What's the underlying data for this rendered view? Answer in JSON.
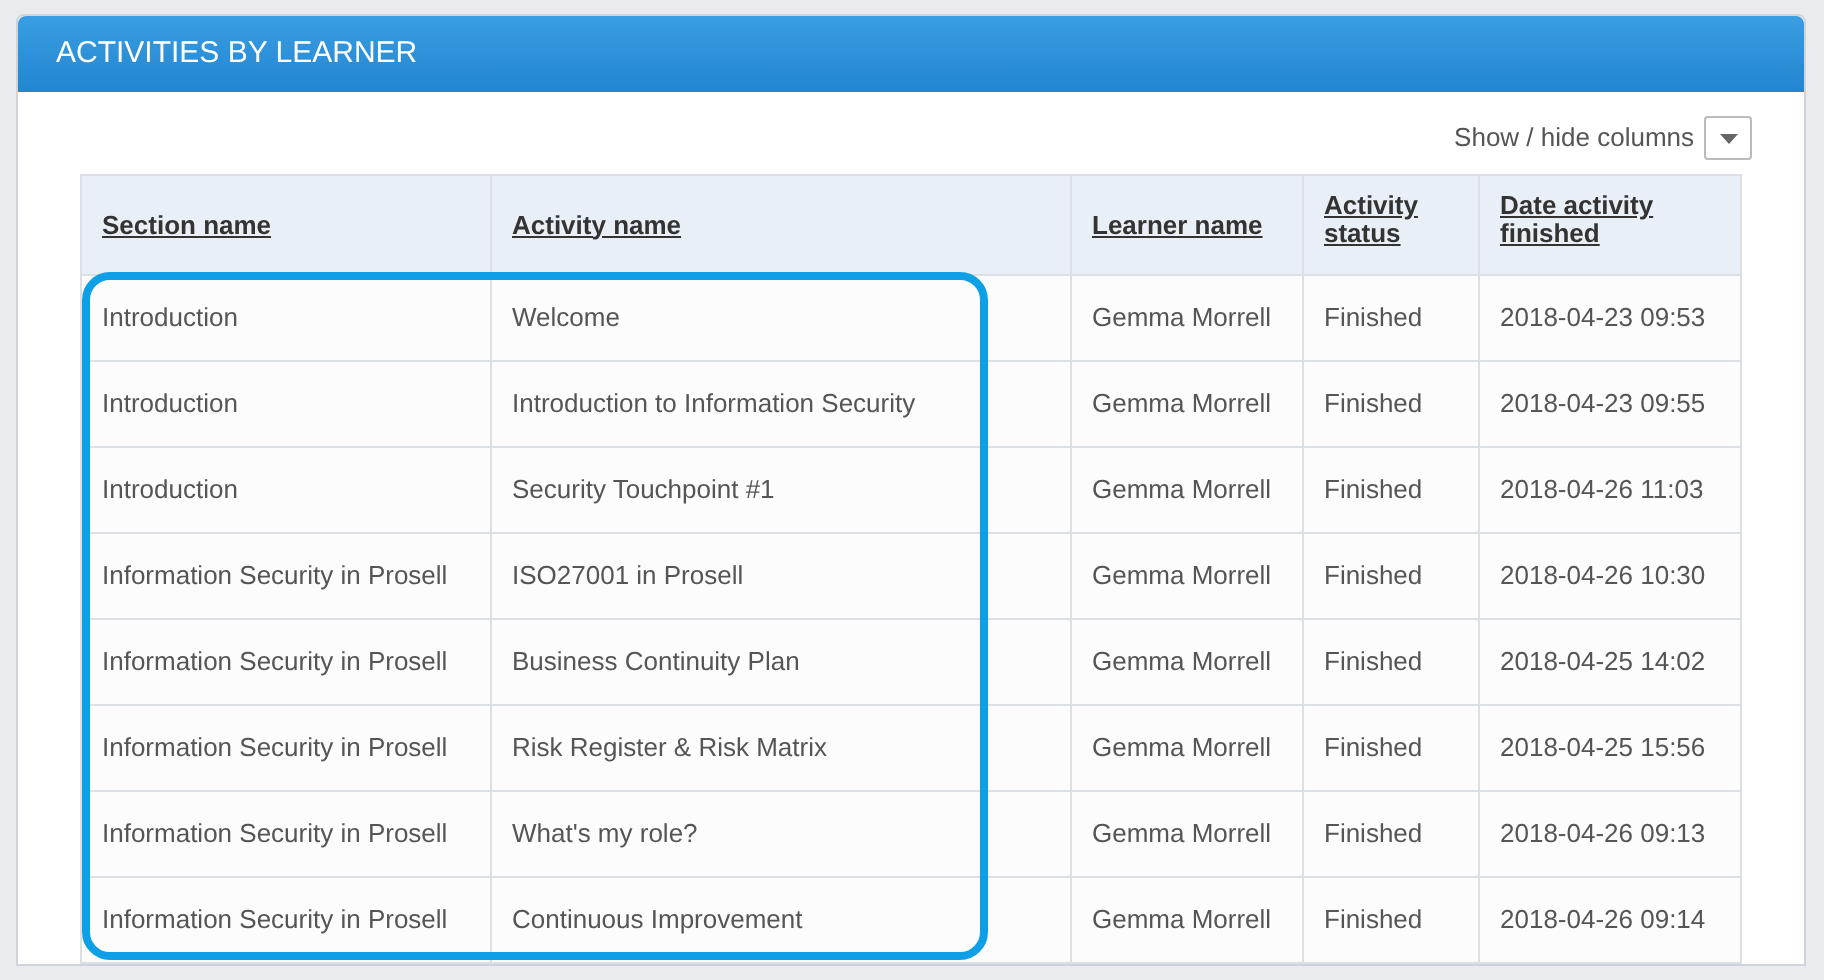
{
  "panel": {
    "title": "ACTIVITIES BY LEARNER"
  },
  "toolbar": {
    "label": "Show / hide columns"
  },
  "table": {
    "columns": [
      "Section name",
      "Activity name",
      "Learner name",
      "Activity status",
      "Date activity finished"
    ],
    "rows": [
      [
        "Introduction",
        "Welcome",
        "Gemma Morrell",
        "Finished",
        "2018-04-23 09:53"
      ],
      [
        "Introduction",
        "Introduction to Information Security",
        "Gemma Morrell",
        "Finished",
        "2018-04-23 09:55"
      ],
      [
        "Introduction",
        "Security Touchpoint #1",
        "Gemma Morrell",
        "Finished",
        "2018-04-26 11:03"
      ],
      [
        "Information Security in Prosell",
        "ISO27001 in Prosell",
        "Gemma Morrell",
        "Finished",
        "2018-04-26 10:30"
      ],
      [
        "Information Security in Prosell",
        "Business Continuity Plan",
        "Gemma Morrell",
        "Finished",
        "2018-04-25 14:02"
      ],
      [
        "Information Security in Prosell",
        "Risk Register & Risk Matrix",
        "Gemma Morrell",
        "Finished",
        "2018-04-25 15:56"
      ],
      [
        "Information Security in Prosell",
        "What's my role?",
        "Gemma Morrell",
        "Finished",
        "2018-04-26 09:13"
      ],
      [
        "Information Security in Prosell",
        "Continuous Improvement",
        "Gemma Morrell",
        "Finished",
        "2018-04-26 09:14"
      ]
    ]
  }
}
